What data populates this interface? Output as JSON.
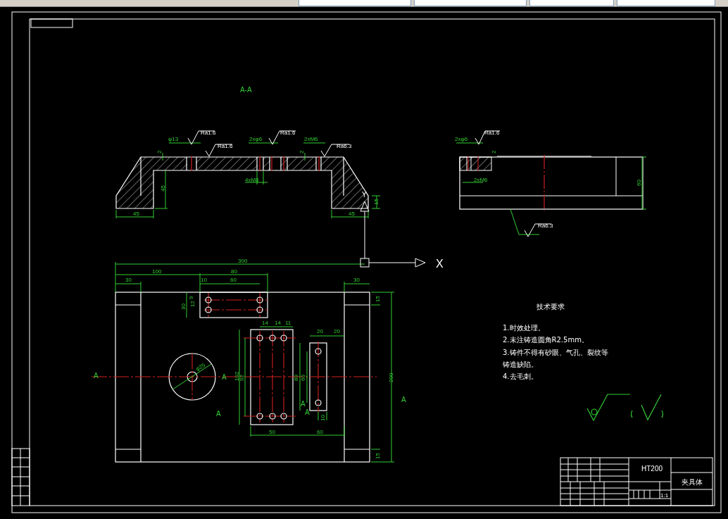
{
  "drawing": {
    "section_view": {
      "title": "A-A",
      "labels": [
        {
          "text": "Ra1.6",
          "kind": "roughness"
        },
        {
          "text": "Ra1.6",
          "kind": "roughness"
        },
        {
          "text": "Ra1.6",
          "kind": "roughness"
        },
        {
          "text": "Ra6.3",
          "kind": "roughness"
        },
        {
          "text": "φ13",
          "kind": "dimension"
        },
        {
          "text": "2xφ6",
          "kind": "dimension"
        },
        {
          "text": "2xM6",
          "kind": "dimension"
        },
        {
          "text": "4xM8",
          "kind": "dimension"
        },
        {
          "text": "2",
          "kind": "dimension"
        },
        {
          "text": "2",
          "kind": "dimension"
        },
        {
          "text": "45",
          "kind": "dimension"
        },
        {
          "text": "45",
          "kind": "dimension"
        },
        {
          "text": "45",
          "kind": "dimension"
        },
        {
          "text": "15",
          "kind": "dimension"
        }
      ]
    },
    "side_view": {
      "labels": [
        {
          "text": "Ra1.6",
          "kind": "roughness"
        },
        {
          "text": "2xφ6",
          "kind": "dimension"
        },
        {
          "text": "2",
          "kind": "dimension"
        },
        {
          "text": "2xM6",
          "kind": "dimension"
        },
        {
          "text": "60",
          "kind": "dimension"
        },
        {
          "text": "Ra6.3",
          "kind": "roughness"
        }
      ]
    },
    "plan_view": {
      "labels": [
        {
          "text": "300",
          "kind": "dimension"
        },
        {
          "text": "100",
          "kind": "dimension"
        },
        {
          "text": "80",
          "kind": "dimension"
        },
        {
          "text": "30",
          "kind": "dimension"
        },
        {
          "text": "10",
          "kind": "dimension"
        },
        {
          "text": "60",
          "kind": "dimension"
        },
        {
          "text": "30",
          "kind": "dimension"
        },
        {
          "text": "9",
          "kind": "dimension"
        },
        {
          "text": "12",
          "kind": "dimension"
        },
        {
          "text": "30",
          "kind": "dimension"
        },
        {
          "text": "14",
          "kind": "dimension"
        },
        {
          "text": "14",
          "kind": "dimension"
        },
        {
          "text": "11",
          "kind": "dimension"
        },
        {
          "text": "20",
          "kind": "dimension"
        },
        {
          "text": "20",
          "kind": "dimension"
        },
        {
          "text": "15",
          "kind": "dimension"
        },
        {
          "text": "φ25",
          "kind": "dimension"
        },
        {
          "text": "102",
          "kind": "dimension"
        },
        {
          "text": "92",
          "kind": "dimension"
        },
        {
          "text": "80",
          "kind": "dimension"
        },
        {
          "text": "60",
          "kind": "dimension"
        },
        {
          "text": "200",
          "kind": "dimension"
        },
        {
          "text": "10",
          "kind": "dimension"
        },
        {
          "text": "50",
          "kind": "dimension"
        },
        {
          "text": "60",
          "kind": "dimension"
        },
        {
          "text": "15",
          "kind": "dimension"
        },
        {
          "text": "A",
          "kind": "section_mark"
        },
        {
          "text": "A",
          "kind": "section_mark"
        },
        {
          "text": "A",
          "kind": "section_mark"
        },
        {
          "text": "A",
          "kind": "section_mark"
        },
        {
          "text": "A",
          "kind": "section_mark"
        },
        {
          "text": "A",
          "kind": "section_mark"
        }
      ]
    },
    "axis_labels": [
      "X",
      "Y"
    ]
  },
  "technical_requirements": {
    "title": "技术要求",
    "items": [
      "1.时效处理。",
      "2.未注铸造圆角R2.5mm。",
      "3.铸件不得有砂眼、气孔、裂纹等",
      "铸造缺陷。",
      "4.去毛刺。"
    ]
  },
  "title_block": {
    "material": "HT200",
    "part_name": "夹具体",
    "scale": "1:1"
  }
}
